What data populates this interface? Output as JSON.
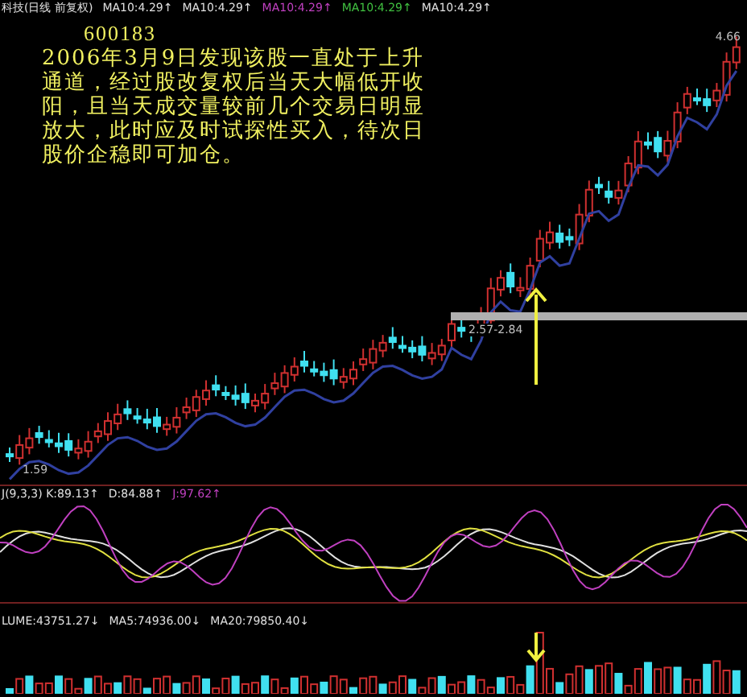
{
  "header": {
    "title": "科技(日线 前复权)",
    "indicators": [
      {
        "label": "MA10:4.29↑",
        "color": "#e0e0e0"
      },
      {
        "label": "MA10:4.29↑",
        "color": "#e0e0e0"
      },
      {
        "label": "MA10:4.29↑",
        "color": "#c040c0"
      },
      {
        "label": "MA10:4.29↑",
        "color": "#40c040"
      },
      {
        "label": "MA10:4.29↑",
        "color": "#e0e0e0"
      }
    ]
  },
  "main_chart": {
    "stock_code": "600183",
    "note": "2006年3月9日发现该股一直处于上升通道，经过股改复权后当天大幅低开收阳，且当天成交量较前几个交易日明显放大，此时应及时试探性买入，待次日股价企稳即可加仓。",
    "high_label": "4.66",
    "range_label": "2.57-2.84",
    "low_label": "1.59"
  },
  "kdj_panel": {
    "indicators": [
      {
        "label": "J(9,3,3) K:89.13↑",
        "color": "#e0e0e0"
      },
      {
        "label": "D:84.88↑",
        "color": "#e0e0e0"
      },
      {
        "label": "J:97.62↑",
        "color": "#c040c0"
      }
    ]
  },
  "volume_panel": {
    "indicators": [
      {
        "label": "LUME:43751.27↓",
        "color": "#e0e0e0"
      },
      {
        "label": "MA5:74936.00↓",
        "color": "#e0e0e0"
      },
      {
        "label": "MA20:79850.40↓",
        "color": "#e0e0e0"
      }
    ]
  }
}
